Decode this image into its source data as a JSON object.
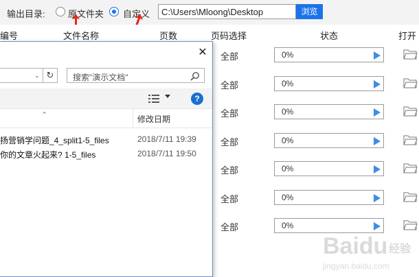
{
  "output_bar": {
    "label": "输出目录:",
    "option_original": "原文件夹",
    "option_custom": "自定义",
    "selected": "custom",
    "path_value": "C:\\Users\\Mloong\\Desktop",
    "browse_label": "浏览"
  },
  "table_header": {
    "col_number": "编号",
    "col_filename": "文件名称",
    "col_pages": "页数",
    "col_page_select": "页码选择",
    "col_status": "状态",
    "col_open": "打开"
  },
  "rows": [
    {
      "page_select": "全部",
      "progress_text": "0%",
      "progress": 0
    },
    {
      "page_select": "全部",
      "progress_text": "0%",
      "progress": 0
    },
    {
      "page_select": "全部",
      "progress_text": "0%",
      "progress": 0
    },
    {
      "page_select": "全部",
      "progress_text": "0%",
      "progress": 0
    },
    {
      "page_select": "全部",
      "progress_text": "0%",
      "progress": 0
    },
    {
      "page_select": "全部",
      "progress_text": "0%",
      "progress": 0
    },
    {
      "page_select": "全部",
      "progress_text": "0%",
      "progress": 0
    }
  ],
  "dialog": {
    "close_glyph": "✕",
    "refresh_glyph": "↻",
    "search_placeholder": "搜索\"演示文档\"",
    "help_glyph": "?",
    "column_date": "修改日期",
    "files": [
      {
        "name": "扬营销学问题_4_split1-5_files",
        "date": "2018/7/11 19:39"
      },
      {
        "name": "你的文章火起来? 1-5_files",
        "date": "2018/7/11 19:50"
      }
    ]
  },
  "colors": {
    "accent": "#1a73e8",
    "play": "#3d8fe0"
  },
  "watermark": {
    "brand": "Baidu",
    "brand_cn": "经验",
    "url": "jingyan.baidu.com"
  }
}
